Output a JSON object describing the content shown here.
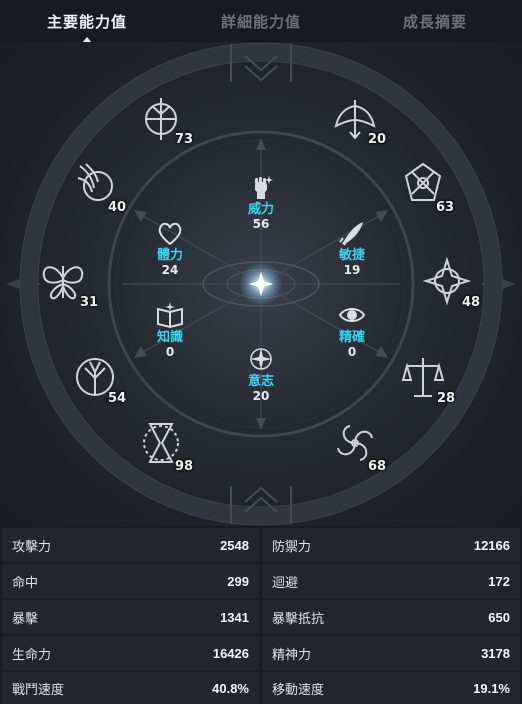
{
  "tabs": [
    {
      "label": "主要能力值",
      "active": true
    },
    {
      "label": "詳細能力值",
      "active": false
    },
    {
      "label": "成長摘要",
      "active": false
    }
  ],
  "outer_ring": [
    {
      "icon": "sword-crest-icon",
      "value": "73"
    },
    {
      "icon": "winged-blade-icon",
      "value": "20"
    },
    {
      "icon": "crossed-axes-icon",
      "value": "63"
    },
    {
      "icon": "star-compass-icon",
      "value": "48"
    },
    {
      "icon": "balance-scale-icon",
      "value": "28"
    },
    {
      "icon": "swirl-wind-icon",
      "value": "68"
    },
    {
      "icon": "hourglass-icon",
      "value": "98"
    },
    {
      "icon": "tree-circle-icon",
      "value": "54"
    },
    {
      "icon": "butterfly-icon",
      "value": "31"
    },
    {
      "icon": "phoenix-icon",
      "value": "40"
    }
  ],
  "core_stats": [
    {
      "id": "power",
      "name": "威力",
      "value": "56",
      "icon": "fist-icon"
    },
    {
      "id": "agility",
      "name": "敏捷",
      "value": "19",
      "icon": "feather-icon"
    },
    {
      "id": "precision",
      "name": "精確",
      "value": "0",
      "icon": "eye-icon"
    },
    {
      "id": "will",
      "name": "意志",
      "value": "20",
      "icon": "sparkle-icon"
    },
    {
      "id": "knowledge",
      "name": "知識",
      "value": "0",
      "icon": "book-icon"
    },
    {
      "id": "vitality",
      "name": "體力",
      "value": "24",
      "icon": "heart-icon"
    }
  ],
  "attributes": [
    {
      "left": {
        "label": "攻擊力",
        "value": "2548"
      },
      "right": {
        "label": "防禦力",
        "value": "12166"
      }
    },
    {
      "left": {
        "label": "命中",
        "value": "299"
      },
      "right": {
        "label": "迴避",
        "value": "172"
      }
    },
    {
      "left": {
        "label": "暴擊",
        "value": "1341"
      },
      "right": {
        "label": "暴擊抵抗",
        "value": "650"
      }
    },
    {
      "left": {
        "label": "生命力",
        "value": "16426"
      },
      "right": {
        "label": "精神力",
        "value": "3178"
      }
    },
    {
      "left": {
        "label": "戰鬥速度",
        "value": "40.8%"
      },
      "right": {
        "label": "移動速度",
        "value": "19.1%"
      }
    }
  ],
  "colors": {
    "accent_cyan": "#39d5ee",
    "panel": "#22252d",
    "background": "#1c1f27"
  }
}
